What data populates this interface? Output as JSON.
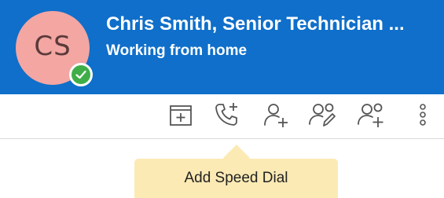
{
  "contact": {
    "initials": "CS",
    "name": "Chris Smith, Senior Technician ...",
    "status": "Working from home",
    "presence": "available"
  },
  "colors": {
    "header_bg": "#0f6fca",
    "avatar_bg": "#f3a6a2",
    "presence_green": "#3fae49",
    "tooltip_bg": "#fbeab4",
    "icon_color": "#555555"
  },
  "toolbar": {
    "buttons": [
      {
        "icon": "calendar-add-icon"
      },
      {
        "icon": "phone-add-icon"
      },
      {
        "icon": "person-add-icon"
      },
      {
        "icon": "group-edit-icon"
      },
      {
        "icon": "group-add-icon"
      },
      {
        "icon": "more-vertical-icon"
      }
    ]
  },
  "tooltip": {
    "text": "Add Speed Dial"
  }
}
